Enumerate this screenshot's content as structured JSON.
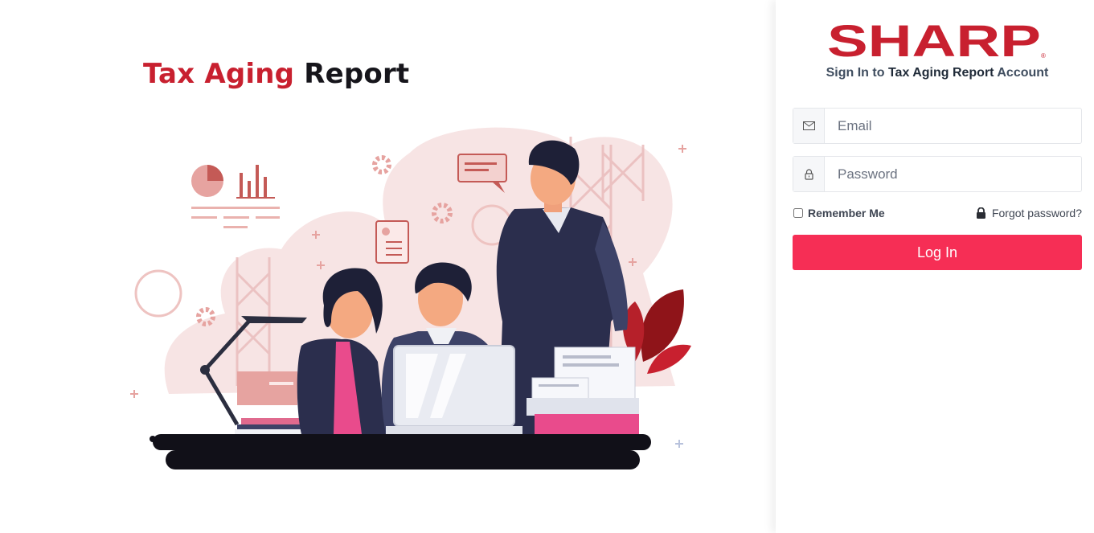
{
  "hero": {
    "title_part1": "Tax Aging",
    "title_part2": "Report"
  },
  "brand": {
    "logo_text": "SHARP",
    "registered_mark": "®",
    "color": "#c8202f"
  },
  "login": {
    "subtitle_prefix": "Sign In to ",
    "subtitle_emphasis": "Tax Aging Report",
    "subtitle_suffix": " Account",
    "email": {
      "placeholder": "Email",
      "value": "",
      "icon": "envelope-icon"
    },
    "password": {
      "placeholder": "Password",
      "value": "",
      "icon": "lock-icon"
    },
    "remember_label": "Remember Me",
    "remember_checked": false,
    "forgot_label": "Forgot password?",
    "forgot_icon": "lock-icon",
    "submit_label": "Log In"
  },
  "colors": {
    "accent": "#f62e55",
    "title_red": "#c8202f",
    "title_dark": "#16151b"
  }
}
